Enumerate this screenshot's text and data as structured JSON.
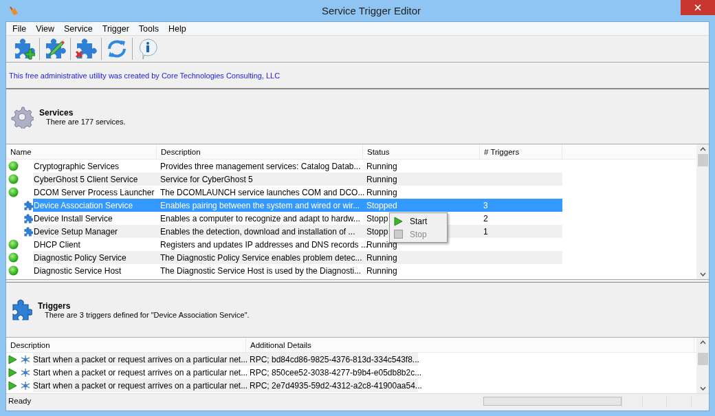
{
  "window": {
    "title": "Service Trigger Editor"
  },
  "menu": [
    "File",
    "View",
    "Service",
    "Trigger",
    "Tools",
    "Help"
  ],
  "toolbar": [
    {
      "kind": "add"
    },
    {
      "kind": "edit"
    },
    {
      "kind": "delete"
    },
    {
      "kind": "refresh"
    },
    {
      "kind": "info"
    }
  ],
  "credit": "This free administrative utility was created by Core Technologies Consulting, LLC",
  "services_header": {
    "title": "Services",
    "subtitle": "There are 177 services."
  },
  "services_table": {
    "columns": [
      "Name",
      "Description",
      "Status",
      "# Triggers"
    ],
    "rows": [
      {
        "kind": "running",
        "selected": false,
        "name": "Cryptographic Services",
        "description": "Provides three management services: Catalog Datab...",
        "status": "Running"
      },
      {
        "kind": "running",
        "selected": false,
        "name": "CyberGhost 5 Client Service",
        "description": "Service for CyberGhost 5",
        "status": "Running"
      },
      {
        "kind": "running",
        "selected": false,
        "name": "DCOM Server Process Launcher",
        "description": "The DCOMLAUNCH service launches COM and DCO...",
        "status": "Running"
      },
      {
        "kind": "stopped",
        "selected": true,
        "name": "Device Association Service",
        "description": "Enables pairing between the system and wired or wir...",
        "status": "Stopped",
        "triggers": "3"
      },
      {
        "kind": "stopped",
        "selected": false,
        "name": "Device Install Service",
        "description": "Enables a computer to recognize and adapt to hardw...",
        "status": "Stopp",
        "triggers": "2"
      },
      {
        "kind": "stopped",
        "selected": false,
        "name": "Device Setup Manager",
        "description": "Enables the detection, download and installation of ...",
        "status": "Stopp",
        "triggers": "1"
      },
      {
        "kind": "running",
        "selected": false,
        "name": "DHCP Client",
        "description": "Registers and updates IP addresses and DNS records ...",
        "status": "Running"
      },
      {
        "kind": "running",
        "selected": false,
        "name": "Diagnostic Policy Service",
        "description": "The Diagnostic Policy Service enables problem detec...",
        "status": "Running"
      },
      {
        "kind": "running",
        "selected": false,
        "name": "Diagnostic Service Host",
        "description": "The Diagnostic Service Host is used by the Diagnosti...",
        "status": "Running"
      }
    ]
  },
  "context_menu": [
    {
      "label": "Start",
      "kind": "start",
      "disabled": false
    },
    {
      "label": "Stop",
      "kind": "stop",
      "disabled": true
    }
  ],
  "triggers_header": {
    "title": "Triggers",
    "subtitle": "There are 3 triggers defined for \"Device Association Service\"."
  },
  "triggers_table": {
    "columns": [
      "Description",
      "Additional Details"
    ],
    "rows": [
      {
        "description": "Start when a packet or request arrives on a particular net...",
        "details": "RPC; bd84cd86-9825-4376-813d-334c543f8..."
      },
      {
        "description": "Start when a packet or request arrives on a particular net...",
        "details": "RPC; 850cee52-3038-4277-b9b4-e05db8b2c..."
      },
      {
        "description": "Start when a packet or request arrives on a particular net...",
        "details": "RPC; 2e7d4935-59d2-4312-a2c8-41900aa54..."
      }
    ]
  },
  "status_bar": {
    "text": "Ready",
    "progress": {
      "level": 0
    }
  }
}
